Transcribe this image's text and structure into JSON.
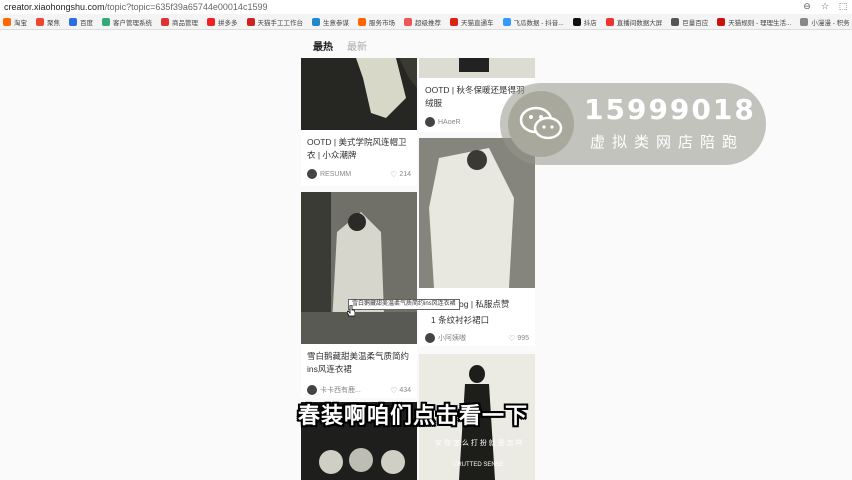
{
  "browser": {
    "url_host": "creator.xiaohongshu.com",
    "url_path": "/topic?topic=635f39a65744e00014c1599"
  },
  "bookmarks": [
    {
      "label": "淘宝",
      "color": "#ff6a00"
    },
    {
      "label": "聚焦",
      "color": "#e43"
    },
    {
      "label": "百度",
      "color": "#2b6de5"
    },
    {
      "label": "客户管理系统",
      "color": "#3a7"
    },
    {
      "label": "商品管理",
      "color": "#d33"
    },
    {
      "label": "拼多多",
      "color": "#e22"
    },
    {
      "label": "天猫手工工作台",
      "color": "#c22"
    },
    {
      "label": "生意参谋",
      "color": "#28c"
    },
    {
      "label": "服务市场",
      "color": "#f60"
    },
    {
      "label": "超级推荐",
      "color": "#e55"
    },
    {
      "label": "天猫直通车",
      "color": "#d21"
    },
    {
      "label": "飞瓜数据 - 抖音...",
      "color": "#39f"
    },
    {
      "label": "抖店",
      "color": "#111"
    },
    {
      "label": "直播间数据大屏",
      "color": "#e33"
    },
    {
      "label": "巨量百应",
      "color": "#555"
    },
    {
      "label": "天猫规则 - 理理生活...",
      "color": "#c11"
    },
    {
      "label": "小漫漫 - 积务",
      "color": "#888"
    }
  ],
  "feed_tabs": {
    "hot": "最热",
    "new": "最新"
  },
  "cards": {
    "left1": {
      "title": "OOTD | 美式学院风连帽卫衣 | 小众潮牌",
      "author": "RESUMM",
      "likes": "214"
    },
    "left2": {
      "title": "雪白鹅藏甜美温柔气质简约ins风连衣裙",
      "author": "卡卡西有鹿...",
      "likes": "434"
    },
    "right1": {
      "title": "OOTD | 秋冬保暖还是得羽绒服",
      "author": "HAoeR"
    },
    "right2": {
      "title": "og | 私服点赞",
      "subtitle": "1 条纹衬衫裙口",
      "author": "小阿姨嗷",
      "likes": "995"
    },
    "right3": {
      "overlay_text": "安 你 怎 么 打 扮 就 是 怎 样",
      "brand": "CRUTTED SENSE"
    }
  },
  "tooltip": "雪白鹅藏甜美温柔气质简约ins风连衣裙",
  "watermark": {
    "phone": "15999018",
    "sub": "虚拟类网店陪跑"
  },
  "subtitle": "春装啊咱们点击看一下"
}
